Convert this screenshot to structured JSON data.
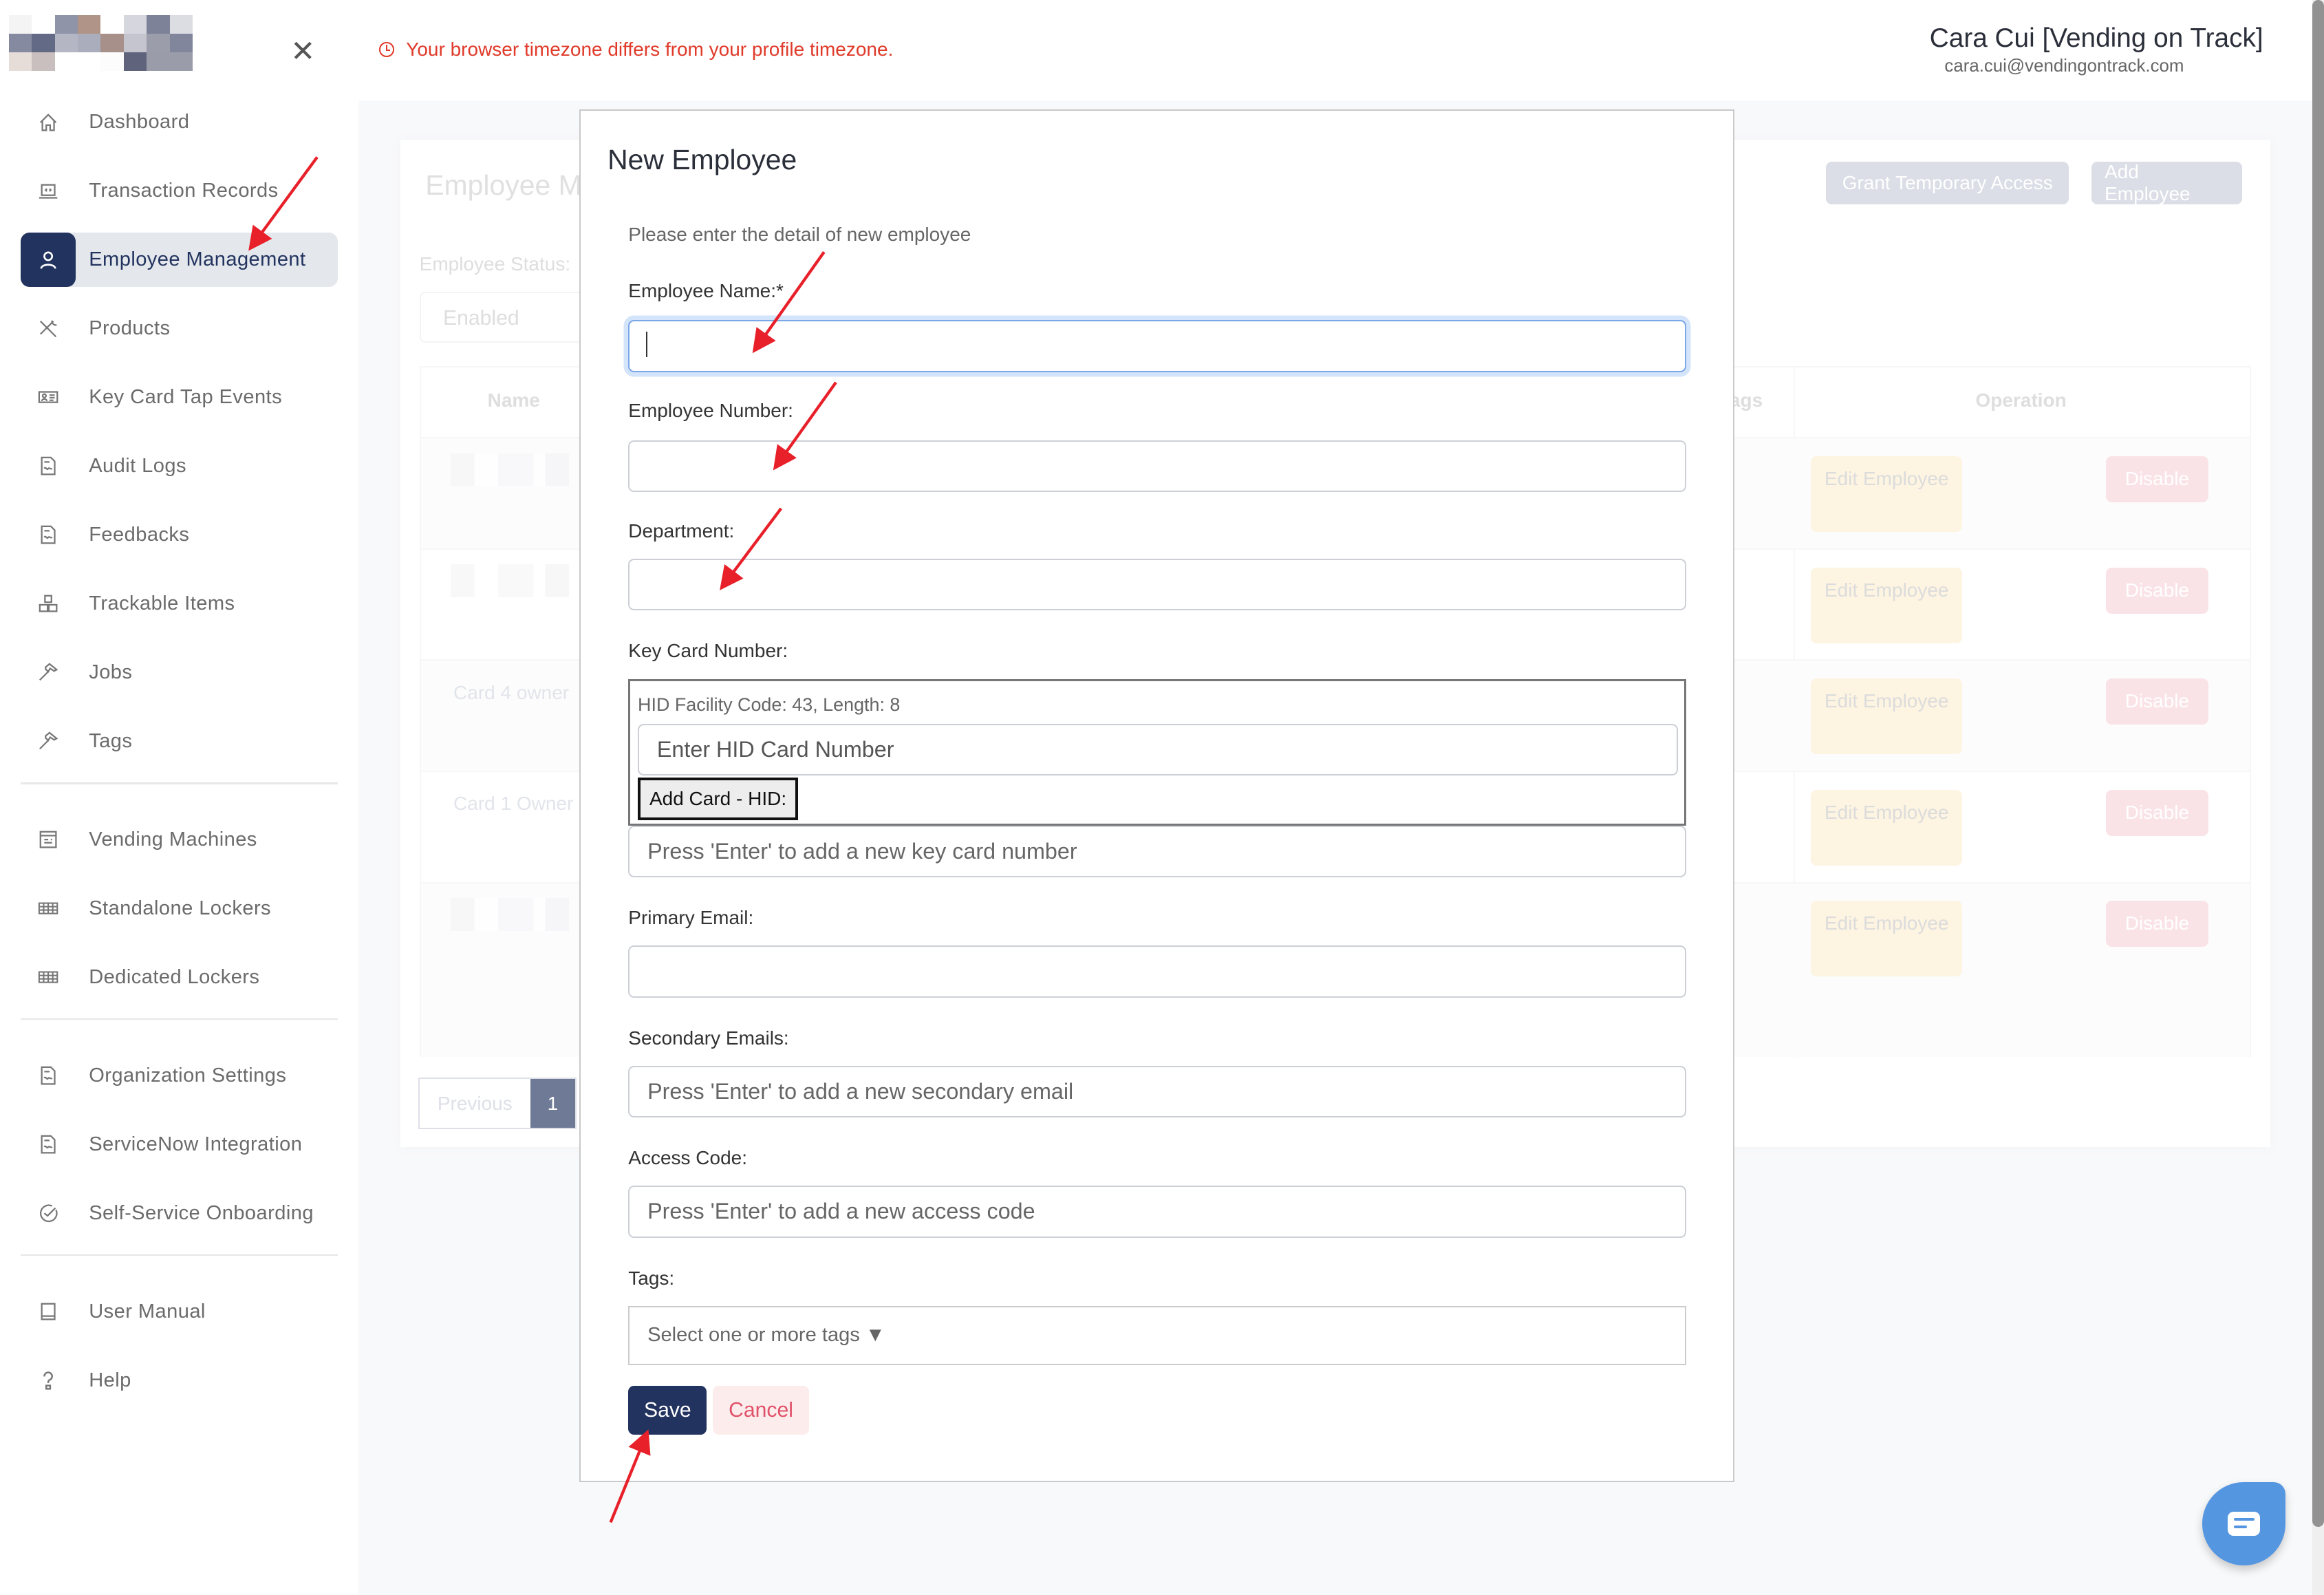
{
  "sidebar": {
    "close_icon": "close-icon",
    "items": [
      {
        "label": "Dashboard",
        "icon": "home-icon"
      },
      {
        "label": "Transaction Records",
        "icon": "laptop-code-icon"
      },
      {
        "label": "Employee Management",
        "icon": "user-icon",
        "active": true
      },
      {
        "label": "Products",
        "icon": "tools-icon"
      },
      {
        "label": "Key Card Tap Events",
        "icon": "id-card-icon"
      },
      {
        "label": "Audit Logs",
        "icon": "document-signature-icon"
      },
      {
        "label": "Feedbacks",
        "icon": "document-signature-icon"
      },
      {
        "label": "Trackable Items",
        "icon": "boxes-icon"
      },
      {
        "label": "Jobs",
        "icon": "hammer-icon"
      },
      {
        "label": "Tags",
        "icon": "hammer-icon"
      }
    ],
    "items2": [
      {
        "label": "Vending Machines",
        "icon": "vending-machine-icon"
      },
      {
        "label": "Standalone Lockers",
        "icon": "grid-icon"
      },
      {
        "label": "Dedicated Lockers",
        "icon": "grid-icon"
      }
    ],
    "items3": [
      {
        "label": "Organization Settings",
        "icon": "document-signature-icon"
      },
      {
        "label": "ServiceNow Integration",
        "icon": "document-signature-icon"
      },
      {
        "label": "Self-Service Onboarding",
        "icon": "check-circle-icon"
      }
    ],
    "items4": [
      {
        "label": "User Manual",
        "icon": "book-icon"
      },
      {
        "label": "Help",
        "icon": "question-icon"
      }
    ]
  },
  "header": {
    "timezone_warning": "Your browser timezone differs from your profile timezone.",
    "user_name": "Cara Cui [Vending on Track]",
    "user_email": "cara.cui@vendingontrack.com"
  },
  "background_page": {
    "title": "Employee M",
    "grant_button": "Grant Temporary Access",
    "add_button": "Add Employee",
    "status_label": "Employee Status:",
    "status_value": "Enabled",
    "columns": {
      "name": "Name",
      "tags": "ags",
      "operation": "Operation"
    },
    "rows": [
      {
        "name": "",
        "edit": "Edit Employee",
        "disable": "Disable"
      },
      {
        "name": "",
        "edit": "Edit Employee",
        "disable": "Disable"
      },
      {
        "name": "Card 4 owner",
        "edit": "Edit Employee",
        "disable": "Disable"
      },
      {
        "name": "Card 1 Owner",
        "edit": "Edit Employee",
        "disable": "Disable"
      },
      {
        "name": "",
        "edit": "Edit Employee",
        "disable": "Disable"
      }
    ],
    "pagination": {
      "previous": "Previous",
      "current": "1"
    }
  },
  "modal": {
    "title": "New Employee",
    "subtitle": "Please enter the detail of new employee",
    "fields": {
      "name_label": "Employee Name:*",
      "name_value": "",
      "number_label": "Employee Number:",
      "number_value": "",
      "department_label": "Department:",
      "department_value": "",
      "keycard_label": "Key Card Number:",
      "hid_info": "HID Facility Code: 43, Length: 8",
      "hid_placeholder": "Enter HID Card Number",
      "hid_button": "Add Card - HID:",
      "keycard_placeholder": "Press 'Enter' to add a new key card number",
      "primary_email_label": "Primary Email:",
      "primary_email_value": "",
      "secondary_emails_label": "Secondary Emails:",
      "secondary_emails_placeholder": "Press 'Enter' to add a new secondary email",
      "access_code_label": "Access Code:",
      "access_code_placeholder": "Press 'Enter' to add a new access code",
      "tags_label": "Tags:",
      "tags_placeholder": "Select one or more tags ▼"
    },
    "save_label": "Save",
    "cancel_label": "Cancel"
  },
  "colors": {
    "brand_navy": "#22335f",
    "warning_red": "#e03a2a",
    "chat_blue": "#5596e1",
    "annotation_red": "#e8202a"
  }
}
